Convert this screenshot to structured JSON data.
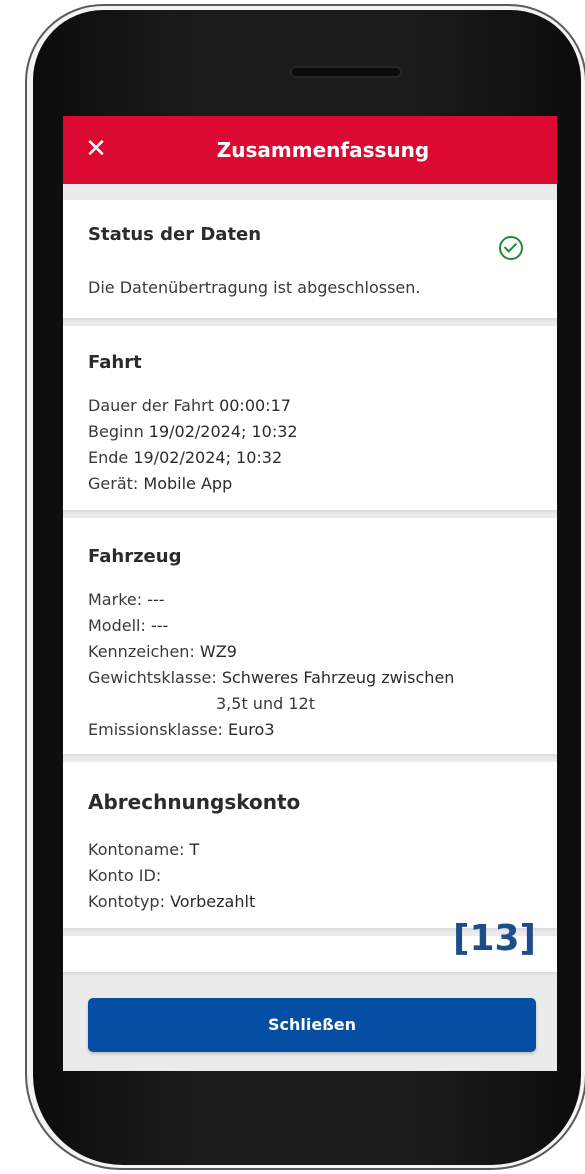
{
  "appbar": {
    "title": "Zusammenfassung",
    "close_icon": "close-icon"
  },
  "status_card": {
    "title": "Status der Daten",
    "message": "Die Datenübertragung ist abgeschlossen.",
    "status_icon": "check-circle-icon",
    "status_color": "#1e8a3c"
  },
  "trip_card": {
    "title": "Fahrt",
    "duration_label": "Dauer der Fahrt",
    "duration_value": "00:00:17",
    "start_label": "Beginn",
    "start_value": "19/02/2024; 10:32",
    "end_label": "Ende",
    "end_value": "19/02/2024; 10:32",
    "device_label": "Gerät:",
    "device_value": "Mobile App"
  },
  "vehicle_card": {
    "title": "Fahrzeug",
    "brand_label": "Marke:",
    "brand_value": "---",
    "model_label": "Modell:",
    "model_value": "---",
    "plate_label": "Kennzeichen:",
    "plate_value": "WZ9",
    "weight_label": "Gewichtsklasse:",
    "weight_value_line1": "Schweres Fahrzeug zwischen",
    "weight_value_line2": "3,5t und 12t",
    "emission_label": "Emissionsklasse:",
    "emission_value": "Euro3"
  },
  "account_card": {
    "title": "Abrechnungskonto",
    "name_label": "Kontoname:",
    "name_value": "T",
    "id_label": "Konto ID:",
    "id_value": "",
    "type_label": "Kontotyp:",
    "type_value": "Vorbezahlt"
  },
  "footer": {
    "close_label": "Schließen"
  },
  "annotation": "[13]",
  "colors": {
    "appbar": "#dc0a32",
    "primary_button": "#064ea3",
    "annotation": "#1d4e8a"
  }
}
